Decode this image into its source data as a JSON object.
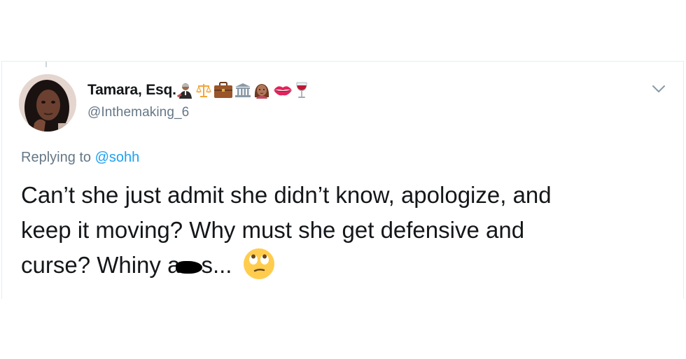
{
  "tweet": {
    "author": {
      "display_name": "Tamara, Esq.",
      "handle": "@Inthemaking_6",
      "name_emojis": [
        "judge-emoji",
        "scales-emoji",
        "briefcase-emoji",
        "classical-building-emoji",
        "woman-emoji",
        "kiss-mark-emoji",
        "wine-glass-emoji"
      ]
    },
    "reply_context": {
      "prefix": "Replying to",
      "mention": "@sohh"
    },
    "text": {
      "part1": "Can’t she just admit she didn’t know, apologize, and",
      "part2": "keep it moving? Why must she get defensive and",
      "part3_before": "curse? Whiny a",
      "part3_after": "s...",
      "trailing_emoji": "face-with-rolling-eyes-emoji"
    },
    "menu_icon": "chevron-down-icon"
  }
}
